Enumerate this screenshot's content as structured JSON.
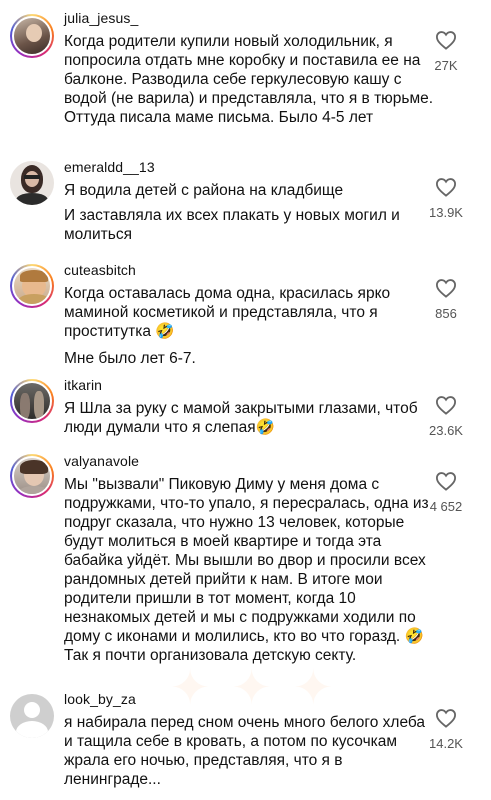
{
  "comments": [
    {
      "username": "julia_jesus_",
      "paragraphs": [
        "Когда родители купили новый холодильник, я попросила отдать мне коробку и поставила ее на балконе. Разводила себе геркулесовую кашу с водой (не варила) и представляла, что я в тюрьме. Оттуда писала маме письма. Было 4-5 лет"
      ],
      "likes": "27K",
      "avatar_story_ring": true
    },
    {
      "username": "emeraldd__13",
      "paragraphs": [
        "Я водила детей с района на кладбище",
        "И заставляла их всех плакать у новых могил и молиться"
      ],
      "likes": "13.9K",
      "avatar_story_ring": false
    },
    {
      "username": "cuteasbitch",
      "paragraphs": [
        "Когда оставалась дома одна, красилась ярко маминой косметикой и представляла, что я проститутка 🤣",
        "Мне было лет 6-7."
      ],
      "likes": "856",
      "avatar_story_ring": true
    },
    {
      "username": "itkarin",
      "paragraphs": [
        "Я Шла за руку с мамой закрытыми глазами, чтоб люди думали что я слепая🤣"
      ],
      "likes": "23.6K",
      "avatar_story_ring": true
    },
    {
      "username": "valyanavole",
      "paragraphs": [
        "Мы \"вызвали\" Пиковую Диму у меня дома с подружками, что-то упало, я пересралась, одна из подруг сказала, что нужно 13 человек, которые будут молиться в моей квартире и тогда эта бабайка уйдёт. Мы вышли во двор и просили всех рандомных детей прийти к нам. В итоге мои родители пришли в тот момент, когда 10 незнакомых детей и мы с подружками ходили по дому с иконами и молились, кто во что горазд. 🤣 Так я почти организовала детскую секту."
      ],
      "likes": "4 652",
      "avatar_story_ring": true
    },
    {
      "username": "look_by_za",
      "paragraphs": [
        "я набирала перед сном очень много белого хлеба и тащила себе в кровать, а потом по кусочкам жрала его ночью, представляя, что я в ленинграде..."
      ],
      "likes": "14.2K",
      "avatar_story_ring": false
    }
  ],
  "icons": {
    "like": "heart-outline-icon",
    "default_avatar": "user-silhouette-icon"
  }
}
